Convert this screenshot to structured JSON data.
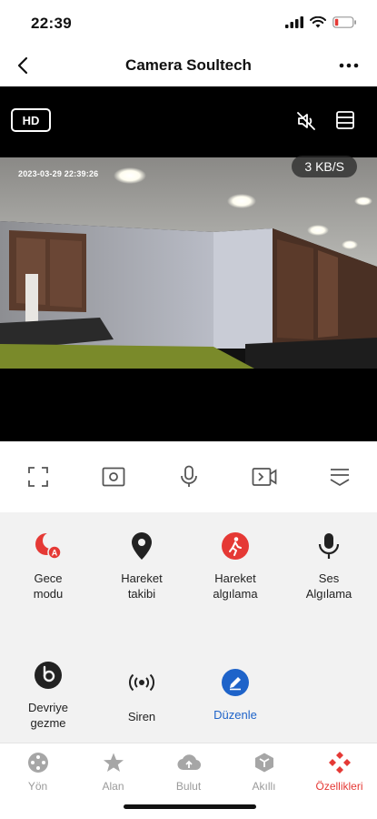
{
  "status_bar": {
    "time": "22:39"
  },
  "nav": {
    "title": "Camera Soultech"
  },
  "video": {
    "quality_label": "HD",
    "bitrate": "3 KB/S",
    "timestamp": "2023-03-29 22:39:26"
  },
  "controls": [
    "fullscreen-icon",
    "snapshot-icon",
    "microphone-icon",
    "record-icon",
    "collapse-icon"
  ],
  "features": [
    {
      "label": "Gece\nmodu",
      "icon": "night-mode-icon",
      "color": "#e53935"
    },
    {
      "label": "Hareket\ntakibi",
      "icon": "location-pin-icon",
      "color": "#222222"
    },
    {
      "label": "Hareket\nalgılama",
      "icon": "walking-person-icon",
      "color": "#e53935"
    },
    {
      "label": "Ses\nAlgılama",
      "icon": "microphone-icon",
      "color": "#222222"
    },
    {
      "label": "Devriye\ngezme",
      "icon": "patrol-icon",
      "color": "#222222"
    },
    {
      "label": "Siren",
      "icon": "siren-icon",
      "color": "#222222"
    },
    {
      "label": "Düzenle",
      "icon": "edit-icon",
      "color": "#1e63c9"
    }
  ],
  "tabs": [
    {
      "label": "Yön",
      "icon": "direction-icon",
      "active": false
    },
    {
      "label": "Alan",
      "icon": "star-icon",
      "active": false
    },
    {
      "label": "Bulut",
      "icon": "cloud-icon",
      "active": false
    },
    {
      "label": "Akıllı",
      "icon": "cube-icon",
      "active": false
    },
    {
      "label": "Özellikleri",
      "icon": "features-icon",
      "active": true
    }
  ],
  "colors": {
    "accent": "#e53935",
    "link": "#1e63c9",
    "panel_bg": "#f2f2f2"
  }
}
